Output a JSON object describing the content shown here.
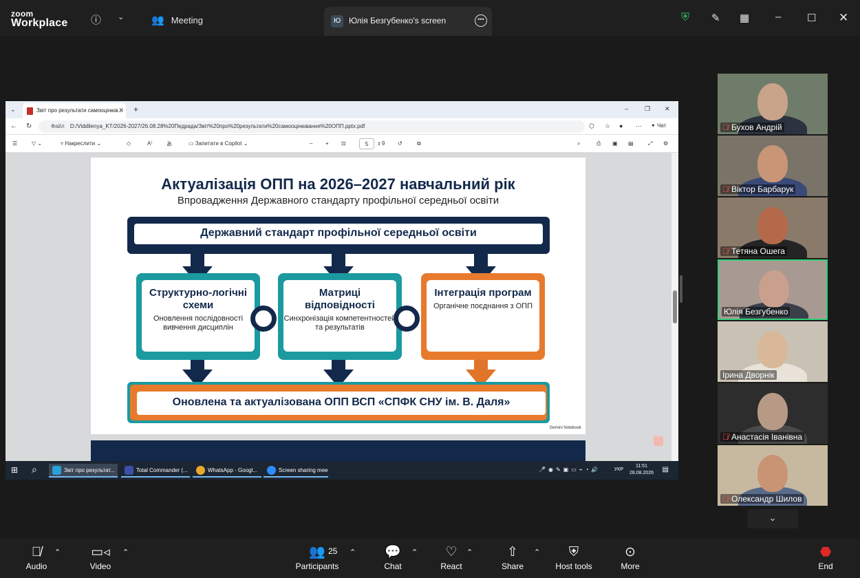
{
  "app": {
    "brand_top": "zoom",
    "brand_bottom": "Workplace",
    "meeting_label": "Meeting",
    "share_badge": "Ю",
    "share_title": "Юлія Безгубенко's screen"
  },
  "browser": {
    "tab_title": "Звіт про результати самооцінюв...",
    "url_prefix": "Файл",
    "url": "D:/Viddilenya_KT/2026-2027/26.08.28%20Педрада/Звіт%20про%20результати%20самооцінювання%20ОПП.pptx.pdf",
    "chat_label": "Чат",
    "draw_label": "Накреслити",
    "copilot_label": "Запитати в Copilot",
    "page_current": "5",
    "page_total": "з 9"
  },
  "slide": {
    "title": "Актуалізація ОПП на 2026–2027 навчальний рік",
    "subtitle": "Впровадження Державного стандарту профільної середньої освіти",
    "top_box": "Державний стандарт профільної середньої освіти",
    "cards": [
      {
        "heading": "Структурно-логічні схеми",
        "desc": "Оновлення послідовності вивчення дисциплін"
      },
      {
        "heading": "Матриці відповідності",
        "desc": "Синхронізація компетентностей та результатів"
      },
      {
        "heading": "Інтеграція програм",
        "desc": "Органічне поєднання з ОПП"
      }
    ],
    "bottom_box": "Оновлена та актуалізована ОПП ВСП «СПФК СНУ ім. В. Даля»",
    "watermark": "Gemini Notebook"
  },
  "taskbar": {
    "items": [
      {
        "label": "Звіт про результат..."
      },
      {
        "label": "Total Commander (..."
      },
      {
        "label": "WhatsApp - Googl..."
      },
      {
        "label": "Screen sharing mee..."
      }
    ],
    "lang": "УКР",
    "time": "11:51",
    "date": "28.08.2026"
  },
  "participants": [
    {
      "name": "Бухов Андрій"
    },
    {
      "name": "Віктор Барбарук"
    },
    {
      "name": "Тетяна Ошега"
    },
    {
      "name": "Юлія Безгубенко"
    },
    {
      "name": "Ірина Дворнік"
    },
    {
      "name": "Анастасія Іванівна"
    },
    {
      "name": "Олександр Шилов"
    }
  ],
  "toolbar": {
    "audio": "Audio",
    "video": "Video",
    "participants": "Participants",
    "participants_count": "25",
    "chat": "Chat",
    "react": "React",
    "share": "Share",
    "host_tools": "Host tools",
    "more": "More",
    "end": "End"
  },
  "colors": {
    "navy": "#13294b",
    "teal": "#1b9aa0",
    "orange": "#e87a2d",
    "active_speaker": "#33d17a",
    "end_red": "#e02828"
  }
}
